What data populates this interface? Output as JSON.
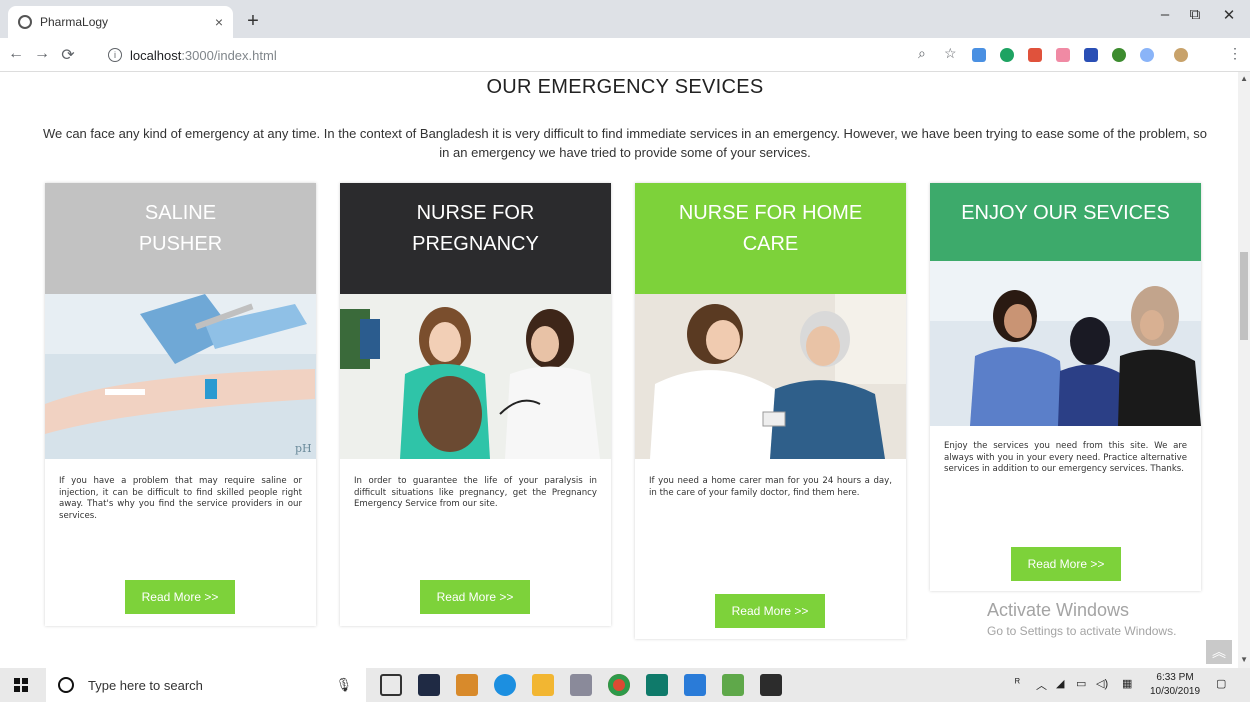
{
  "browser": {
    "tab_title": "PharmaLogy",
    "tab_close": "×",
    "new_tab": "+",
    "url_host": "localhost",
    "url_path": ":3000/index.html",
    "window_controls": [
      "–",
      "⧉",
      "✕"
    ]
  },
  "section": {
    "title": "OUR EMERGENCY SEVICES",
    "description": "We can face any kind of emergency at any time. In the context of Bangladesh it is very difficult to find immediate services in an emergency. However, we have been trying to ease some of the problem, so in an emergency we have tried to provide some of your services."
  },
  "cards": [
    {
      "title_line1": "SALINE",
      "title_line2": "PUSHER",
      "header_color": "#c2c2c2",
      "image_icon": "saline-arm-photo",
      "text": "If you have a problem that may require saline or injection, it can be difficult to find skilled people right away. That's why you find the service providers in our services.",
      "button": "Read More >>"
    },
    {
      "title_line1": "NURSE FOR",
      "title_line2": "PREGNANCY",
      "header_color": "#2b2b2d",
      "image_icon": "pregnancy-checkup-photo",
      "text": "In order to guarantee the life of your paralysis in difficult situations like pregnancy, get the Pregnancy Emergency Service from our site.",
      "button": "Read More >>"
    },
    {
      "title_line1": "NURSE FOR HOME",
      "title_line2": "CARE",
      "header_color": "#7dd23a",
      "image_icon": "home-care-photo",
      "text": "If you need a home carer man for you 24 hours a day, in the care of your family doctor, find them here.",
      "button": "Read More >>"
    },
    {
      "title_line1": "ENJOY OUR SEVICES",
      "title_line2": "",
      "header_color": "#3daa6b",
      "image_icon": "nurse-family-photo",
      "text": "Enjoy the services you need from this site. We are always with you in your every need. Practice alternative services in addition to our emergency services. Thanks.",
      "button": "Read More >>"
    }
  ],
  "watermark": {
    "line1": "Activate Windows",
    "line2": "Go to Settings to activate Windows."
  },
  "taskbar": {
    "search_placeholder": "Type here to search",
    "time": "6:33 PM",
    "date": "10/30/2019"
  }
}
